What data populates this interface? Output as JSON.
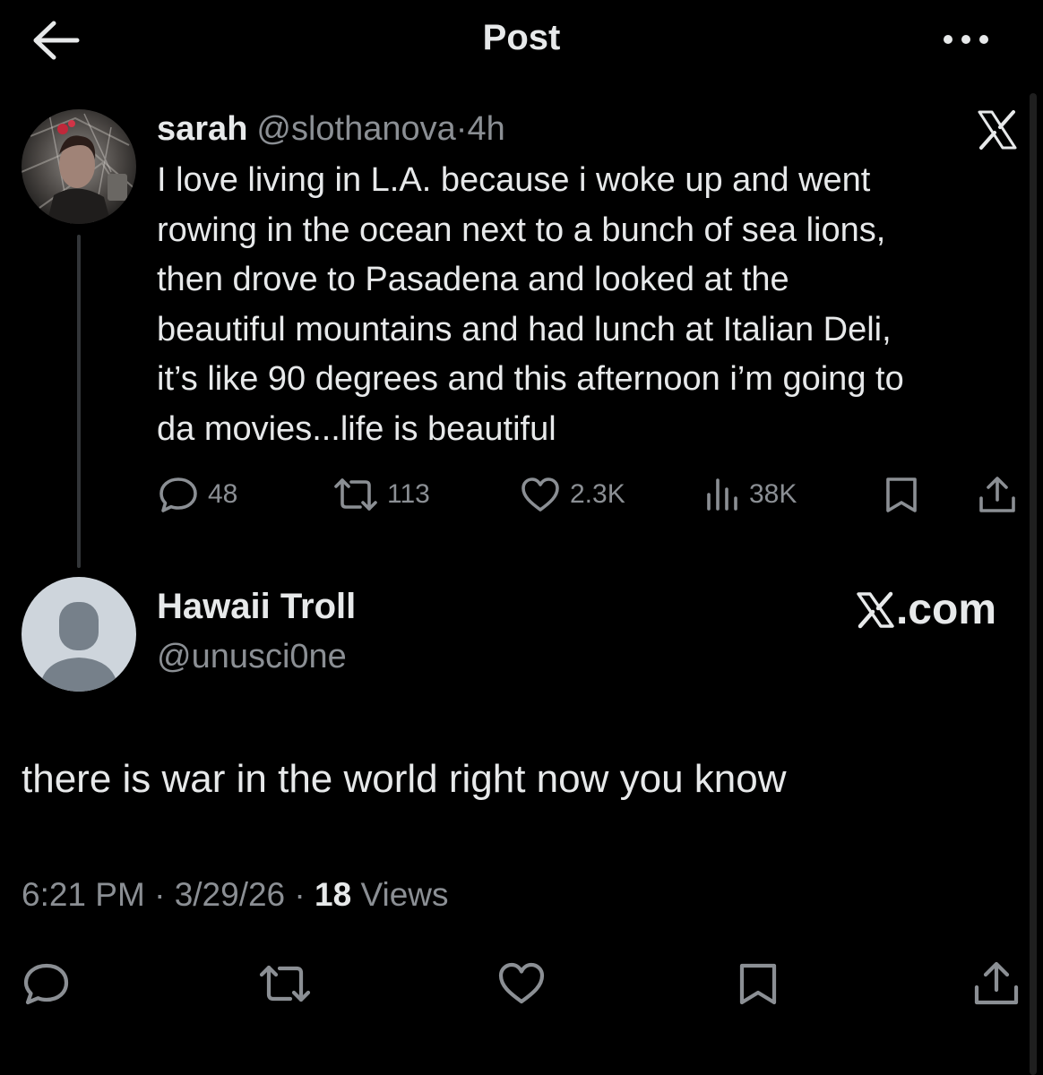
{
  "header": {
    "title": "Post"
  },
  "quoted_tweet": {
    "display_name": "sarah",
    "handle": "@slothanova",
    "separator": "·",
    "time": "4h",
    "body_lines": [
      "I love living in L.A. because i woke up and went",
      "rowing in the ocean next to a bunch of sea lions,",
      "then drove to Pasadena and looked at the",
      "beautiful mountains and had lunch at Italian Deli,",
      "it’s like 90 degrees and this afternoon i’m going to",
      "da movies...life is beautiful"
    ],
    "stats": {
      "replies": "48",
      "reposts": "113",
      "likes": "2.3K",
      "views": "38K"
    }
  },
  "reply": {
    "display_name": "Hawaii Troll",
    "handle": "@unusci0ne",
    "watermark": ".com",
    "text": "there is war in the world right now you know",
    "time": "6:21 PM",
    "separator": "·",
    "date": "3/29/26",
    "views_count": "18",
    "views_label": "Views"
  },
  "colors": {
    "background": "#000000",
    "text_primary": "#e7e9ea",
    "text_secondary": "#8b8f94",
    "default_avatar_bg": "#ced5dc",
    "default_avatar_fg": "#76808a"
  },
  "icons": {
    "back": "arrow-left-icon",
    "more": "more-horizontal-icon",
    "reply": "speech-bubble-icon",
    "repost": "repost-arrows-icon",
    "like": "heart-icon",
    "views": "bar-chart-icon",
    "bookmark": "bookmark-icon",
    "share": "share-upload-icon",
    "x_logo": "x-logo-icon"
  }
}
